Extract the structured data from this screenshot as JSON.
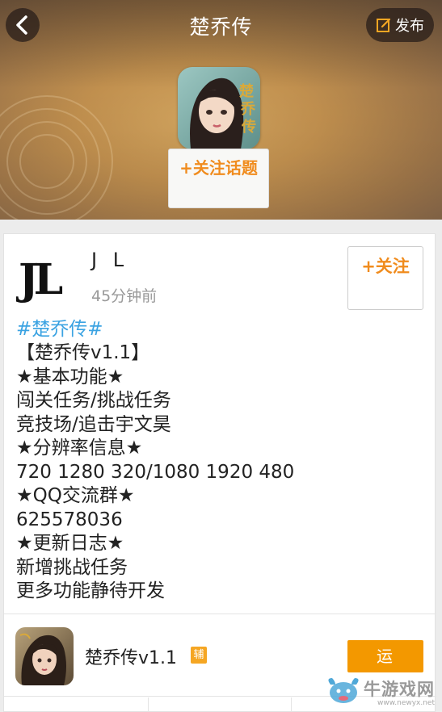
{
  "header": {
    "title": "楚乔传",
    "publish_label": "发布",
    "follow_topic_label": "+关注话题"
  },
  "post": {
    "username": "J L",
    "time": "45分钟前",
    "follow_label": "+关注",
    "tag": "#楚乔传#",
    "lines": [
      "【楚乔传v1.1】",
      "★基本功能★",
      "闯关任务/挑战任务",
      "竞技场/追击宇文昊",
      "★分辨率信息★",
      "720 1280 320/1080 1920 480",
      "★QQ交流群★",
      "625578036",
      "★更新日志★",
      "新增挑战任务",
      "更多功能静待开发"
    ]
  },
  "app": {
    "name": "楚乔传v1.1",
    "badge": "辅",
    "run_label": "运"
  },
  "watermark": {
    "brand": "牛游戏网",
    "url": "www.newyx.net"
  },
  "colors": {
    "accent": "#f08c1e",
    "run_button": "#f39800",
    "tag": "#3ba3e2"
  }
}
